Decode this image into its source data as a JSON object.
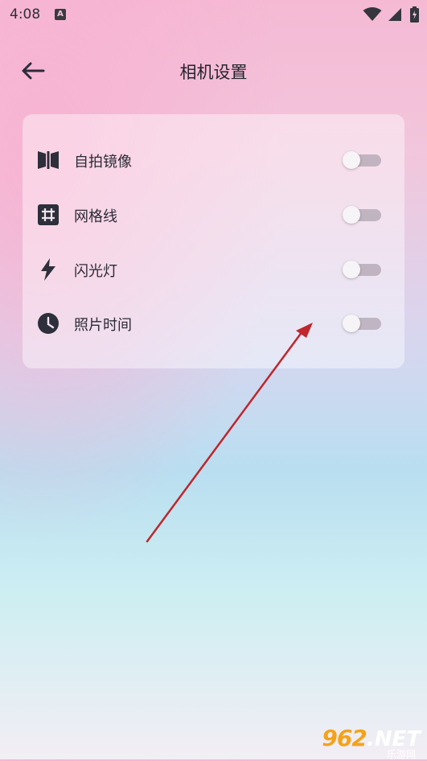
{
  "status_bar": {
    "time": "4:08",
    "notification_icon_letter": "A"
  },
  "header": {
    "title": "相机设置",
    "back_icon": "arrow-left-icon"
  },
  "settings": [
    {
      "label": "自拍镜像",
      "icon": "mirror-icon",
      "enabled": false
    },
    {
      "label": "网格线",
      "icon": "grid-icon",
      "enabled": false
    },
    {
      "label": "闪光灯",
      "icon": "flash-icon",
      "enabled": false
    },
    {
      "label": "照片时间",
      "icon": "clock-icon",
      "enabled": false
    }
  ],
  "watermark": {
    "brand": "962",
    "suffix": ".NET",
    "subtitle": "乐游网"
  },
  "colors": {
    "arrow": "#c0262c",
    "icon": "#2d2f3b",
    "toggle_track": "#b9acb9"
  }
}
